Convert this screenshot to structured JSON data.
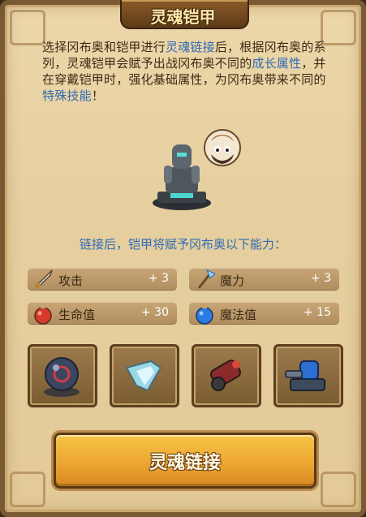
{
  "title": "灵魂铠甲",
  "description": {
    "p1": "选择冈布奥和铠甲进行",
    "h1": "灵魂链接",
    "p2": "后，根据冈布奥的系列，灵魂铠甲会赋予出战冈布奥不同的",
    "h2": "成长属性",
    "p3": "，并在穿戴铠甲时，强化基础属性，为冈布奥带来不同的",
    "h3": "特殊技能",
    "p4": "！"
  },
  "subtitle": "链接后，铠甲将赋予冈布奥以下能力：",
  "stats": [
    {
      "icon": "sword-icon",
      "label": "攻击",
      "value": "+ 3"
    },
    {
      "icon": "magic-axe-icon",
      "label": "魔力",
      "value": "+ 3"
    },
    {
      "icon": "red-potion-icon",
      "label": "生命值",
      "value": "+ 30"
    },
    {
      "icon": "blue-potion-icon",
      "label": "魔法值",
      "value": "+ 15"
    }
  ],
  "equipment_slots": [
    {
      "icon": "dark-orb-icon"
    },
    {
      "icon": "crystal-shard-icon"
    },
    {
      "icon": "red-cannon-icon"
    },
    {
      "icon": "blue-turret-icon"
    }
  ],
  "button": {
    "label": "灵魂链接"
  },
  "colors": {
    "highlight": "#2f6bb5",
    "button": "#eda632",
    "panel": "#e6cf9f"
  }
}
